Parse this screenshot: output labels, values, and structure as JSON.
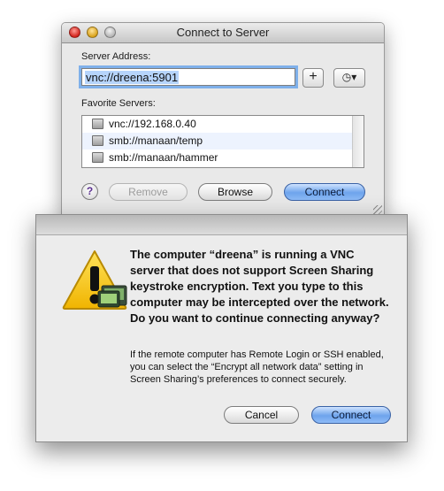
{
  "window": {
    "title": "Connect to Server",
    "server_address_label": "Server Address:",
    "server_address_value": "vnc://dreena:5901",
    "add_button_label": "+",
    "recent_button_label": "◷▾",
    "favorites_label": "Favorite Servers:",
    "favorites": [
      {
        "label": "vnc://192.168.0.40"
      },
      {
        "label": "smb://manaan/temp"
      },
      {
        "label": "smb://manaan/hammer"
      }
    ],
    "help_label": "?",
    "remove_label": "Remove",
    "browse_label": "Browse",
    "connect_label": "Connect"
  },
  "alert": {
    "message": "The computer “dreena” is running a VNC server that does not support Screen Sharing keystroke encryption. Text you type to this computer may be intercepted over the network. Do you want to continue connecting anyway?",
    "informative": "If the remote computer has Remote Login or SSH enabled, you can select the “Encrypt all network data” setting in Screen Sharing’s preferences to connect securely.",
    "cancel_label": "Cancel",
    "connect_label": "Connect"
  },
  "colors": {
    "default_button": "#6da3ec",
    "focus_ring": "#7fb0ea",
    "warning_yellow": "#f5c400"
  },
  "icons": {
    "warning": "caution-triangle-icon",
    "app_badge": "screen-sharing-icon",
    "server": "server-icon"
  }
}
